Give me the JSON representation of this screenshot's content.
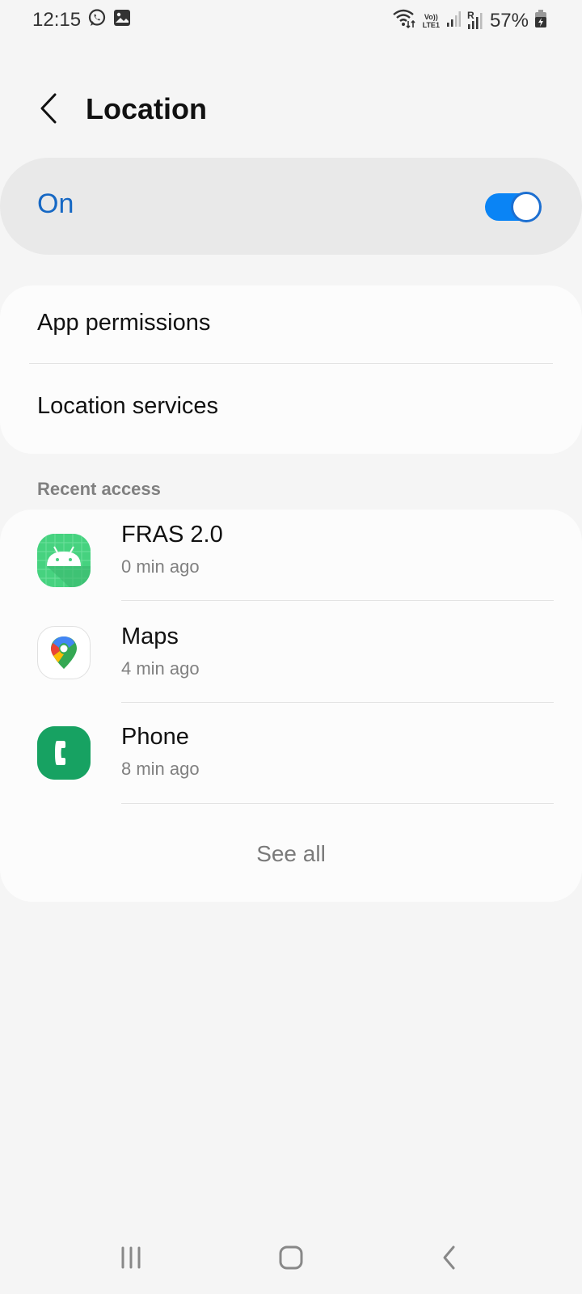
{
  "status_bar": {
    "time": "12:15",
    "notification_icons": [
      "whatsapp-icon",
      "gallery-icon"
    ],
    "system_icons": [
      "wifi-icon",
      "volte-lte1-icon",
      "signal-sim1-icon",
      "signal-sim2-roaming-icon",
      "battery-charging-icon"
    ],
    "volte_line1": "Vo))",
    "volte_line2": "LTE1",
    "roaming_letter": "R",
    "battery": "57%"
  },
  "header": {
    "title": "Location",
    "back_icon": "chevron-left-icon"
  },
  "master_switch": {
    "label": "On",
    "enabled": true,
    "accent_color": "#0a84f5",
    "label_color": "#1668c4"
  },
  "settings": {
    "items": [
      {
        "label": "App permissions"
      },
      {
        "label": "Location services"
      }
    ]
  },
  "recent_access": {
    "section_title": "Recent access",
    "apps": [
      {
        "name": "FRAS 2.0",
        "time": "0 min ago",
        "icon": "android-app-icon"
      },
      {
        "name": "Maps",
        "time": "4 min ago",
        "icon": "google-maps-icon"
      },
      {
        "name": "Phone",
        "time": "8 min ago",
        "icon": "phone-app-icon"
      }
    ],
    "see_all_label": "See all"
  },
  "nav_bar": {
    "buttons": [
      "recent-apps-icon",
      "home-icon",
      "back-icon"
    ]
  }
}
